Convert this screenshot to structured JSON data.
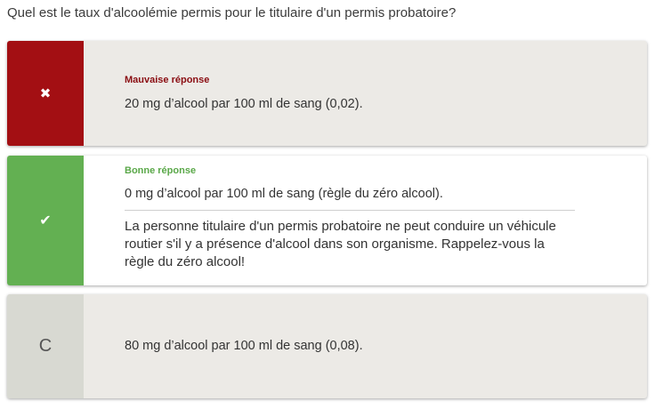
{
  "question": "Quel est le taux d'alcoolémie permis pour le titulaire d'un permis probatoire?",
  "answers": [
    {
      "marker": "✖",
      "marker_icon": "cross-icon",
      "status": "Mauvaise réponse",
      "text": "20 mg d’alcool par 100 ml de sang (0,02).",
      "state": "wrong"
    },
    {
      "marker": "✔",
      "marker_icon": "check-icon",
      "status": "Bonne réponse",
      "text": "0 mg d’alcool par 100 ml de sang (règle du zéro alcool).",
      "explanation": "La personne titulaire d'un permis probatoire ne peut conduire un véhicule routier s'il y a présence d'alcool dans son organisme. Rappelez-vous la règle du zéro alcool!",
      "state": "correct"
    },
    {
      "marker": "C",
      "text": "80 mg d’alcool par 100 ml de sang (0,08).",
      "state": "neutral"
    }
  ],
  "colors": {
    "wrong": "#a30f13",
    "correct": "#63b052",
    "neutral": "#d8d9d2",
    "card_bg": "#eceae6"
  }
}
